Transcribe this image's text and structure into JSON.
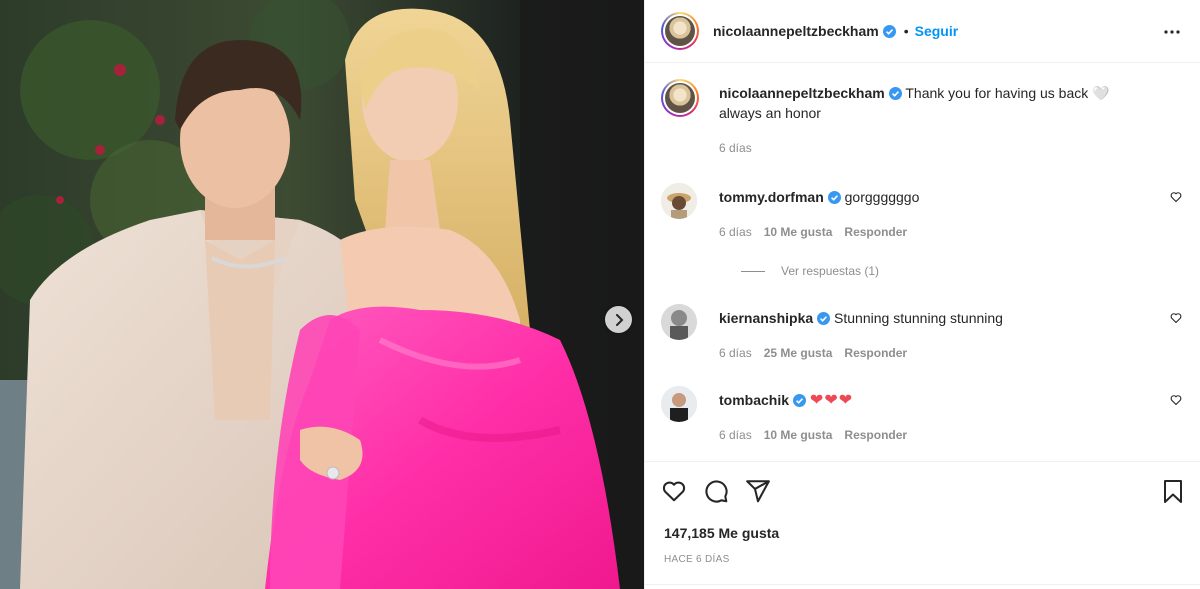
{
  "post": {
    "author": "nicolaannepeltzbeckham",
    "follow_label": "Seguir",
    "separator": "•",
    "caption": "Thank you for having us back 🤍 always an honor",
    "caption_time": "6 días"
  },
  "comments": [
    {
      "user": "tommy.dorfman",
      "text": "gorggggggo",
      "time": "6 días",
      "likes": "10 Me gusta",
      "reply": "Responder",
      "view_replies": "Ver respuestas (1)"
    },
    {
      "user": "kiernanshipka",
      "text": "Stunning stunning stunning",
      "time": "6 días",
      "likes": "25 Me gusta",
      "reply": "Responder"
    },
    {
      "user": "tombachik",
      "text": "❤❤❤",
      "time": "6 días",
      "likes": "10 Me gusta",
      "reply": "Responder"
    }
  ],
  "footer": {
    "likes": "147,185 Me gusta",
    "posted": "HACE 6 DÍAS"
  },
  "icons": {
    "verified": "verified-badge-icon",
    "more": "more-options-icon",
    "like": "heart-icon",
    "comment": "comment-icon",
    "share": "share-icon",
    "save": "bookmark-icon",
    "next": "chevron-right-icon"
  },
  "colors": {
    "accent": "#0095f6",
    "verified": "#3897f0",
    "heart": "#ed4956",
    "dress": "#ff3fb0"
  }
}
